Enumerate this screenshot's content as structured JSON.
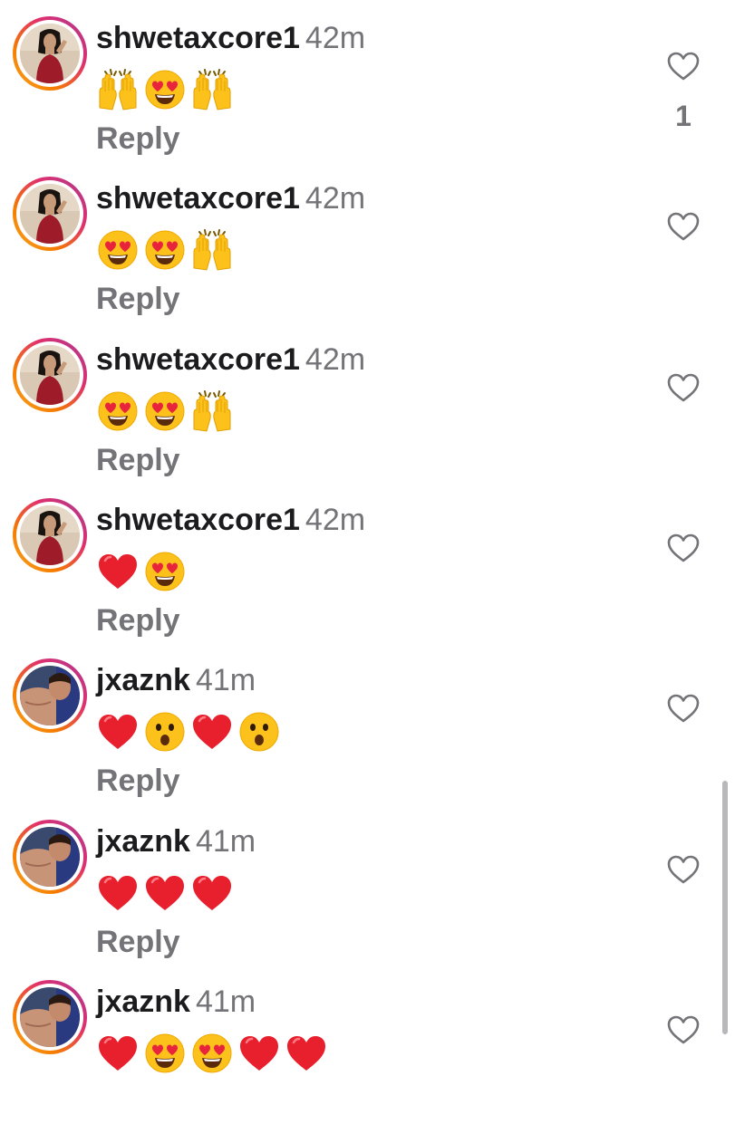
{
  "comments": [
    {
      "username": "shwetaxcore1",
      "time": "42m",
      "emojis": [
        "raised-hands",
        "heart-eyes",
        "raised-hands"
      ],
      "reply": "Reply",
      "like_count": "1",
      "avatar": "woman-red-dress"
    },
    {
      "username": "shwetaxcore1",
      "time": "42m",
      "emojis": [
        "heart-eyes",
        "heart-eyes",
        "raised-hands"
      ],
      "reply": "Reply",
      "like_count": "",
      "avatar": "woman-red-dress"
    },
    {
      "username": "shwetaxcore1",
      "time": "42m",
      "emojis": [
        "heart-eyes",
        "heart-eyes",
        "raised-hands"
      ],
      "reply": "Reply",
      "like_count": "",
      "avatar": "woman-red-dress"
    },
    {
      "username": "shwetaxcore1",
      "time": "42m",
      "emojis": [
        "red-heart",
        "heart-eyes"
      ],
      "reply": "Reply",
      "like_count": "",
      "avatar": "woman-red-dress"
    },
    {
      "username": "jxaznk",
      "time": "41m",
      "emojis": [
        "red-heart",
        "surprised-face",
        "red-heart",
        "surprised-face"
      ],
      "reply": "Reply",
      "like_count": "",
      "avatar": "man-selfie"
    },
    {
      "username": "jxaznk",
      "time": "41m",
      "emojis": [
        "red-heart",
        "red-heart",
        "red-heart"
      ],
      "reply": "Reply",
      "like_count": "",
      "avatar": "man-selfie"
    },
    {
      "username": "jxaznk",
      "time": "41m",
      "emojis": [
        "red-heart",
        "heart-eyes",
        "heart-eyes",
        "red-heart",
        "red-heart"
      ],
      "reply": "",
      "like_count": "",
      "avatar": "man-selfie"
    }
  ],
  "icons": {
    "like": "heart-outline-icon"
  },
  "colors": {
    "text": "#1c1c1e",
    "secondary": "#737378",
    "heart": "#e0245e"
  }
}
